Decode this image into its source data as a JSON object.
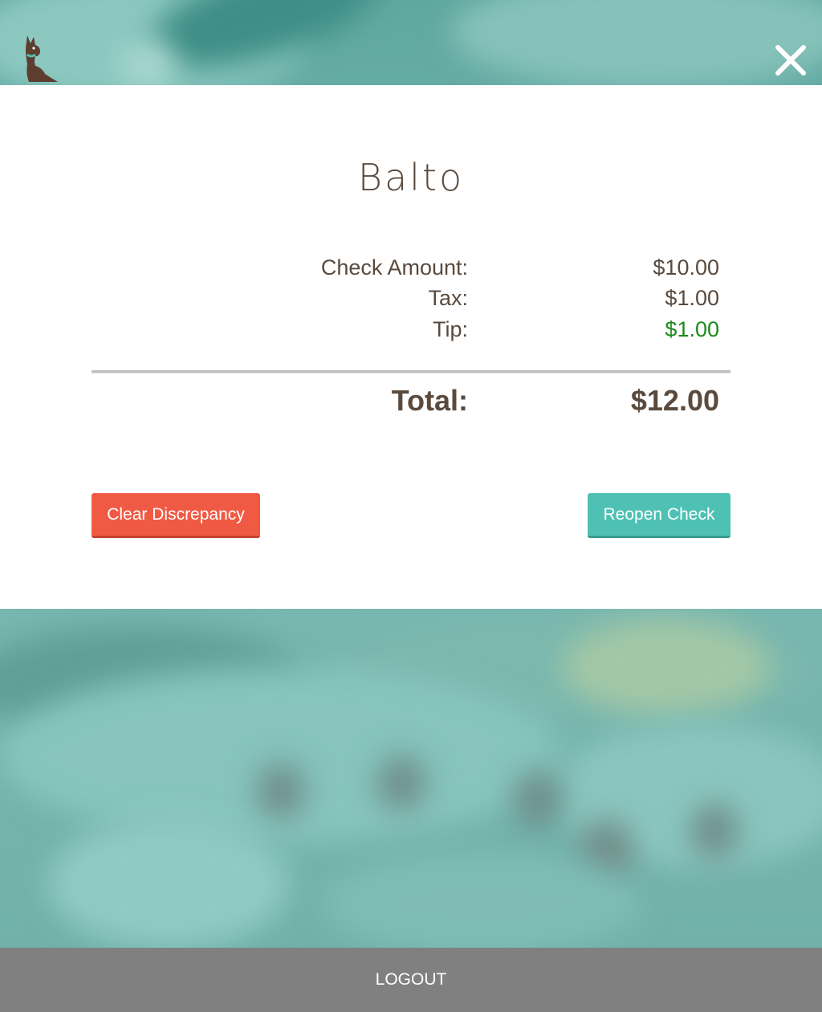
{
  "brand": {
    "logo_icon": "dog-icon",
    "accent_color": "#4fc1b4",
    "danger_color": "#f05a45"
  },
  "header": {
    "close_icon": "close-icon"
  },
  "check": {
    "name": "Balto",
    "check_amount_label": "Check Amount:",
    "check_amount_value": "$10.00",
    "tax_label": "Tax:",
    "tax_value": "$1.00",
    "tip_label": "Tip:",
    "tip_value": "$1.00",
    "total_label": "Total:",
    "total_value": "$12.00"
  },
  "actions": {
    "clear_label": "Clear Discrepancy",
    "reopen_label": "Reopen Check"
  },
  "footer": {
    "logout_label": "LOGOUT"
  }
}
